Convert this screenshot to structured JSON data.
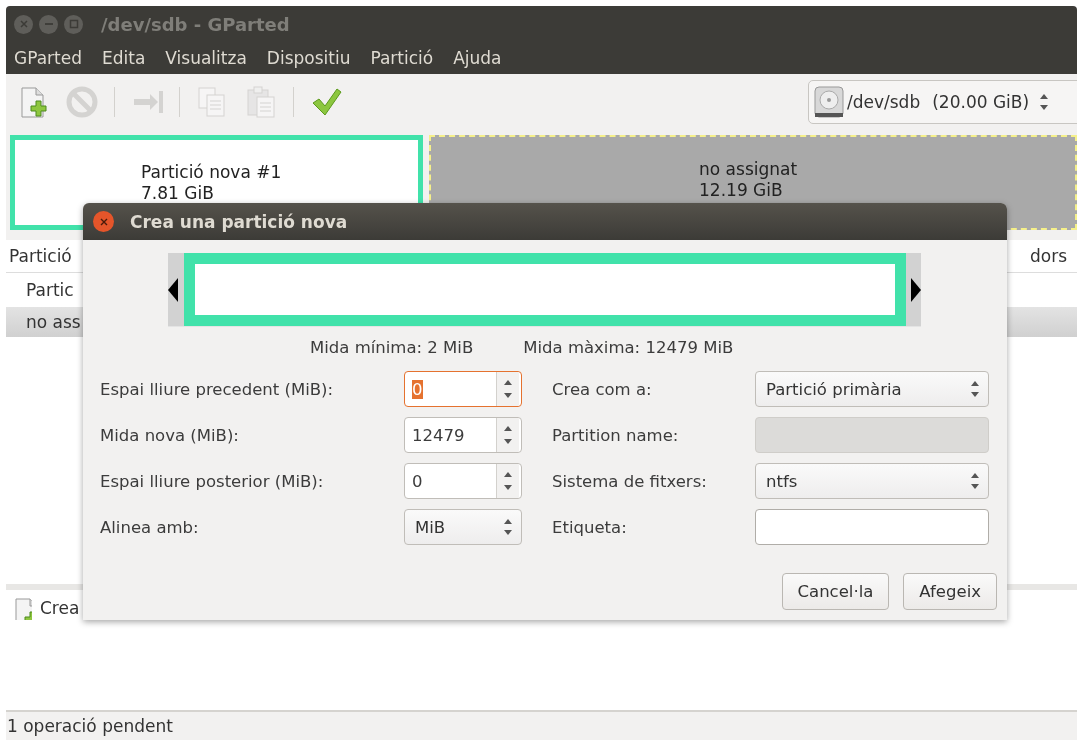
{
  "window": {
    "title": "/dev/sdb - GParted"
  },
  "menu": [
    "GParted",
    "Edita",
    "Visualitza",
    "Dispositiu",
    "Partició",
    "Ajuda"
  ],
  "toolbar": [
    {
      "kind": "new",
      "disabled": false
    },
    {
      "kind": "cancel",
      "disabled": true
    },
    {
      "kind": "separator"
    },
    {
      "kind": "resize",
      "disabled": true
    },
    {
      "kind": "separator"
    },
    {
      "kind": "copy",
      "disabled": true
    },
    {
      "kind": "paste",
      "disabled": true
    },
    {
      "kind": "separator"
    },
    {
      "kind": "apply",
      "disabled": false
    }
  ],
  "device": {
    "name": "/dev/sdb",
    "size": "(20.00 GiB)"
  },
  "disk_map": [
    {
      "kind": "partition",
      "name": "Partició nova #1",
      "size": "7.81 GiB",
      "selected": true
    },
    {
      "kind": "unallocated",
      "name": "no assignat",
      "size": "12.19 GiB",
      "selected": false
    }
  ],
  "partition_list": {
    "columns": [
      "Partició",
      "dors"
    ],
    "rows": [
      {
        "text": "Partic",
        "selected": false
      },
      {
        "text": "no ass",
        "selected": true
      }
    ]
  },
  "operations": [
    "Crea"
  ],
  "status_bar": "1 operació pendent",
  "dialog": {
    "title": "Crea una partició nova",
    "min_size": "Mida mínima: 2 MiB",
    "max_size": "Mida màxima: 12479 MiB",
    "left_fields": [
      {
        "kind": "spin",
        "label": "Espai lliure precedent (MiB):",
        "value": "0",
        "focused": true
      },
      {
        "kind": "spin",
        "label": "Mida nova (MiB):",
        "value": "12479",
        "focused": false
      },
      {
        "kind": "spin",
        "label": "Espai lliure posterior (MiB):",
        "value": "0",
        "focused": false
      },
      {
        "kind": "combo",
        "label": "Alinea amb:",
        "value": "MiB"
      }
    ],
    "right_fields": [
      {
        "kind": "combo",
        "label": "Crea com a:",
        "value": "Partició primària"
      },
      {
        "kind": "entry",
        "label": "Partition name:",
        "disabled": true
      },
      {
        "kind": "combo",
        "label": "Sistema de fitxers:",
        "value": "ntfs"
      },
      {
        "kind": "entry",
        "label": "Etiqueta:",
        "disabled": false
      }
    ],
    "buttons": [
      "Cancel·la",
      "Afegeix"
    ]
  }
}
